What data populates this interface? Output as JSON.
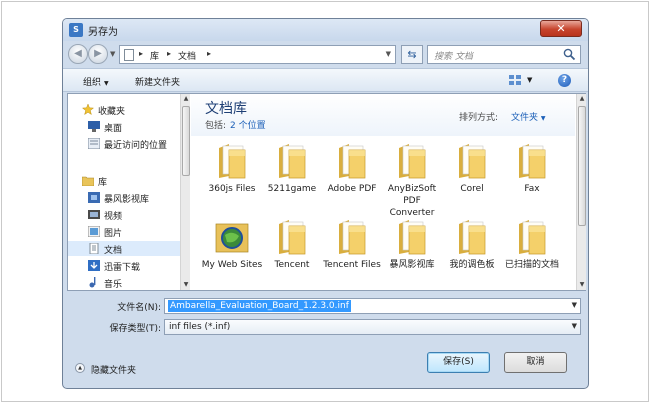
{
  "window": {
    "title": "另存为",
    "close_glyph": "✕"
  },
  "address": {
    "crumbs": [
      "库",
      "文档"
    ],
    "search_placeholder": "搜索 文档"
  },
  "toolbar": {
    "organize": "组织",
    "new_folder": "新建文件夹",
    "help": "?"
  },
  "nav": {
    "items": [
      {
        "label": "收藏夹",
        "icon": "star-icon"
      },
      {
        "label": "桌面",
        "icon": "desktop-icon"
      },
      {
        "label": "最近访问的位置",
        "icon": "recent-places-icon"
      },
      {
        "label": "库",
        "icon": "library-icon"
      },
      {
        "label": "暴风影视库",
        "icon": "video-library-icon"
      },
      {
        "label": "视频",
        "icon": "video-icon"
      },
      {
        "label": "图片",
        "icon": "pictures-icon"
      },
      {
        "label": "文档",
        "icon": "documents-icon"
      },
      {
        "label": "迅雷下载",
        "icon": "download-icon"
      },
      {
        "label": "音乐",
        "icon": "music-icon"
      }
    ],
    "selected": "文档"
  },
  "library": {
    "title": "文档库",
    "includes_label": "包括:",
    "includes_link": "2 个位置",
    "arrange_label": "排列方式:",
    "arrange_value": "文件夹"
  },
  "files": [
    {
      "name": "360js Files",
      "icon": "folder-icon"
    },
    {
      "name": "5211game",
      "icon": "folder-icon"
    },
    {
      "name": "Adobe PDF",
      "icon": "folder-icon"
    },
    {
      "name": "AnyBizSoft PDF Converter",
      "icon": "folder-icon"
    },
    {
      "name": "Corel",
      "icon": "folder-icon"
    },
    {
      "name": "Fax",
      "icon": "folder-icon"
    },
    {
      "name": "My Web Sites",
      "icon": "web-folder-icon"
    },
    {
      "name": "Tencent",
      "icon": "folder-icon"
    },
    {
      "name": "Tencent Files",
      "icon": "folder-icon"
    },
    {
      "name": "暴风影视库",
      "icon": "folder-icon"
    },
    {
      "name": "我的调色板",
      "icon": "folder-icon"
    },
    {
      "name": "已扫描的文档",
      "icon": "folder-icon"
    }
  ],
  "form": {
    "filename_label": "文件名(N):",
    "filename_value": "Ambarella_Evaluation_Board_1.2.3.0.inf",
    "type_label": "保存类型(T):",
    "type_value": "inf files (*.inf)"
  },
  "footer": {
    "hide_folders": "隐藏文件夹",
    "save": "保存(S)",
    "cancel": "取消"
  },
  "colors": {
    "accent": "#1b5fb8",
    "selection": "#3399ff",
    "folder": "#f4d06a"
  }
}
